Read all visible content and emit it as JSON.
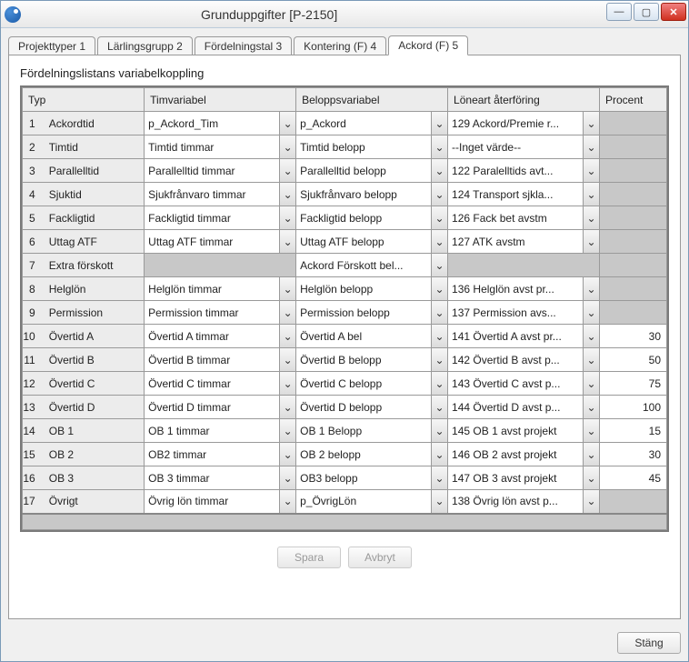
{
  "window": {
    "title": "Grunduppgifter [P-2150]"
  },
  "tabs": [
    {
      "label": "Projekttyper 1"
    },
    {
      "label": "Lärlingsgrupp 2"
    },
    {
      "label": "Fördelningstal 3"
    },
    {
      "label": "Kontering (F) 4"
    },
    {
      "label": "Ackord (F) 5"
    }
  ],
  "section_title": "Fördelningslistans variabelkoppling",
  "columns": {
    "typ": "Typ",
    "timvariabel": "Timvariabel",
    "beloppsvariabel": "Beloppsvariabel",
    "loneart": "Löneart återföring",
    "procent": "Procent"
  },
  "rows": [
    {
      "n": "1",
      "typ": "Ackordtid",
      "tim": "p_Ackord_Tim",
      "bel": "p_Ackord",
      "lon": "129 Ackord/Premie r...",
      "pct": "",
      "grey": true
    },
    {
      "n": "2",
      "typ": "Timtid",
      "tim": "Timtid timmar",
      "bel": "Timtid belopp",
      "lon": "--Inget värde--",
      "pct": "",
      "grey": true
    },
    {
      "n": "3",
      "typ": "Parallelltid",
      "tim": "Parallelltid timmar",
      "bel": "Parallelltid belopp",
      "lon": "122 Paralelltids avt...",
      "pct": "",
      "grey": true
    },
    {
      "n": "4",
      "typ": "Sjuktid",
      "tim": "Sjukfrånvaro timmar",
      "bel": "Sjukfrånvaro belopp",
      "lon": "124 Transport sjkla...",
      "pct": "",
      "grey": true
    },
    {
      "n": "5",
      "typ": "Fackligtid",
      "tim": "Fackligtid timmar",
      "bel": "Fackligtid belopp",
      "lon": "126 Fack bet avstm",
      "pct": "",
      "grey": true
    },
    {
      "n": "6",
      "typ": "Uttag ATF",
      "tim": "Uttag ATF timmar",
      "bel": "Uttag ATF belopp",
      "lon": "127 ATK avstm",
      "pct": "",
      "grey": true
    },
    {
      "n": "7",
      "typ": "Extra förskott",
      "tim": "",
      "bel": "Ackord Förskott bel...",
      "lon": "",
      "pct": "",
      "grey": true,
      "timdisabled": true,
      "londisabled": true
    },
    {
      "n": "8",
      "typ": "Helglön",
      "tim": "Helglön timmar",
      "bel": "Helglön belopp",
      "lon": "136 Helglön avst pr...",
      "pct": "",
      "grey": true
    },
    {
      "n": "9",
      "typ": "Permission",
      "tim": "Permission timmar",
      "bel": "Permission belopp",
      "lon": "137 Permission avs...",
      "pct": "",
      "grey": true
    },
    {
      "n": "10",
      "typ": "Övertid A",
      "tim": "Övertid A timmar",
      "bel": "Övertid A bel",
      "lon": "141 Övertid A avst pr...",
      "pct": "30"
    },
    {
      "n": "11",
      "typ": "Övertid B",
      "tim": "Övertid B timmar",
      "bel": "Övertid B belopp",
      "lon": "142 Övertid B avst p...",
      "pct": "50"
    },
    {
      "n": "12",
      "typ": "Övertid C",
      "tim": "Övertid C timmar",
      "bel": "Övertid C belopp",
      "lon": "143 Övertid C avst p...",
      "pct": "75"
    },
    {
      "n": "13",
      "typ": "Övertid D",
      "tim": "Övertid D timmar",
      "bel": "Övertid D belopp",
      "lon": "144 Övertid D avst p...",
      "pct": "100"
    },
    {
      "n": "14",
      "typ": "OB 1",
      "tim": "OB 1 timmar",
      "bel": "OB 1 Belopp",
      "lon": "145 OB 1 avst projekt",
      "pct": "15"
    },
    {
      "n": "15",
      "typ": "OB 2",
      "tim": "OB2 timmar",
      "bel": "OB 2 belopp",
      "lon": "146 OB 2 avst projekt",
      "pct": "30"
    },
    {
      "n": "16",
      "typ": "OB 3",
      "tim": "OB 3 timmar",
      "bel": "OB3 belopp",
      "lon": "147 OB 3 avst projekt",
      "pct": "45"
    },
    {
      "n": "17",
      "typ": "Övrigt",
      "tim": "Övrig lön timmar",
      "bel": "p_ÖvrigLön",
      "lon": "138 Övrig lön avst p...",
      "pct": "",
      "grey": true
    }
  ],
  "buttons": {
    "save": "Spara",
    "cancel": "Avbryt",
    "close": "Stäng"
  }
}
